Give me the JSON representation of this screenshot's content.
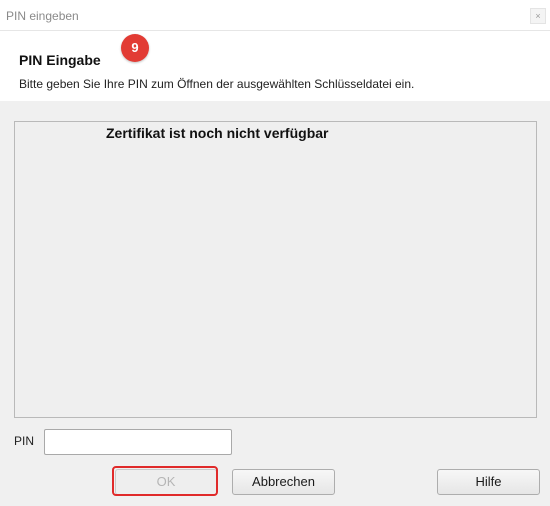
{
  "window": {
    "title": "PIN eingeben",
    "close_label": "×"
  },
  "header": {
    "heading": "PIN Eingabe",
    "subtext": "Bitte geben Sie Ihre PIN zum Öffnen der ausgewählten Schlüsseldatei ein.",
    "step_badge": "9"
  },
  "certificate": {
    "message": "Zertifikat ist noch nicht verfügbar"
  },
  "pin": {
    "label": "PIN",
    "value": ""
  },
  "buttons": {
    "ok": "OK",
    "cancel": "Abbrechen",
    "help": "Hilfe"
  },
  "colors": {
    "highlight": "#e02a2a",
    "badge": "#e23b34"
  }
}
